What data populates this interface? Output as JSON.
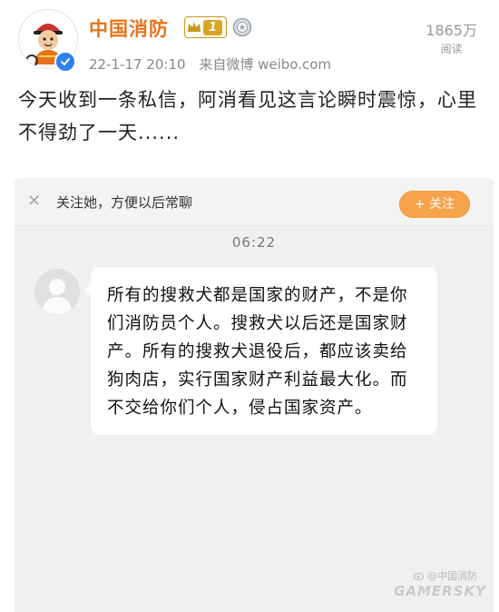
{
  "post": {
    "author": "中国消防",
    "level_badge": "1",
    "date": "22-1-17 20:10",
    "source": "来自微博 weibo.com",
    "reads_count": "1865万",
    "reads_label": "阅读",
    "text": "今天收到一条私信，阿消看见这言论瞬时震惊，心里不得劲了一天......"
  },
  "chat": {
    "follow_hint": "关注她，方便以后常聊",
    "follow_button": "+ 关注",
    "time": "06:22",
    "message": "所有的搜救犬都是国家的财产，不是你们消防员个人。搜救犬以后还是国家财产。所有的搜救犬退役后，都应该卖给狗肉店，实行国家财产利益最大化。而不交给你们个人，侵占国家资产。"
  },
  "watermark": {
    "text": "@中国消防",
    "brand": "GAMERSKY"
  },
  "colors": {
    "author": "#e8721b",
    "follow_button": "#f7a34b",
    "verified": "#2f80ed",
    "level_badge": "#d9a422"
  },
  "icons": [
    "verified-icon",
    "level-badge-icon",
    "medal-icon",
    "close-icon",
    "default-avatar-icon"
  ]
}
